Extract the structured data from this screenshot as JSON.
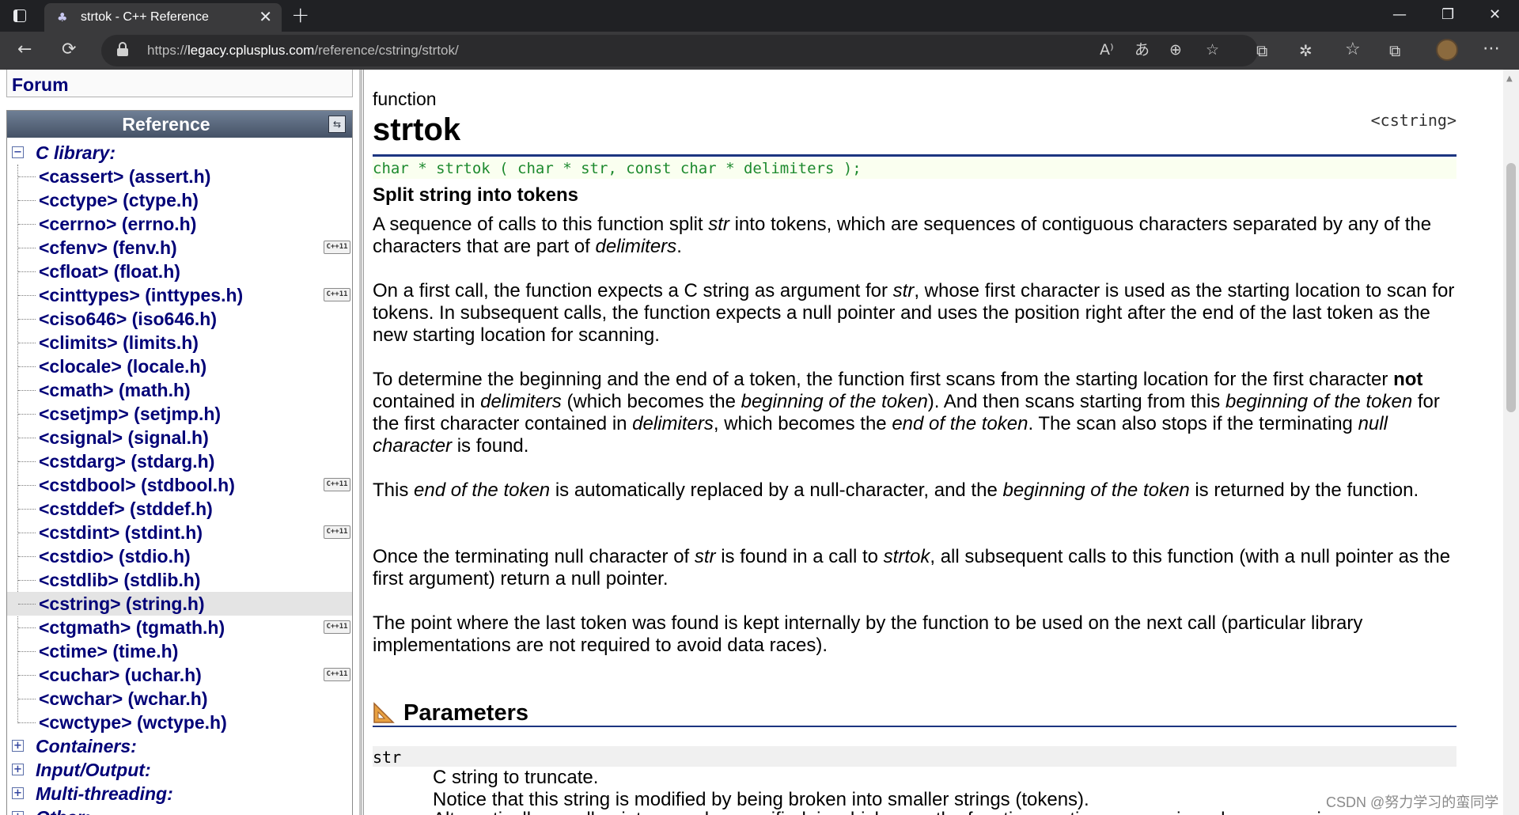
{
  "browser": {
    "tab_title": "strtok - C++ Reference",
    "url_prefix": "https://",
    "url_host": "legacy.cplusplus.com",
    "url_path": "/reference/cstring/strtok/",
    "close_glyph": "✕",
    "new_tab_glyph": "+",
    "minimize_glyph": "—",
    "maximize_glyph": "❐",
    "window_close_glyph": "✕",
    "icons": {
      "back": "←",
      "refresh": "⟳",
      "read_aloud": "A⁾",
      "translate": "あ",
      "zoom": "⊕",
      "favorite_add": "☆",
      "extension1": "⧉",
      "extension2": "✲",
      "favorites": "☆",
      "collections": "⧉",
      "more": "⋯"
    }
  },
  "sidebar": {
    "forum_label": "Forum",
    "reference_title": "Reference",
    "ref_toggle_glyph": "⇆",
    "expanded_category": "C library:",
    "expander_minus": "−",
    "expander_plus": "+",
    "libraries": [
      {
        "label": "<cassert> (assert.h)",
        "cpp": false
      },
      {
        "label": "<cctype> (ctype.h)",
        "cpp": false
      },
      {
        "label": "<cerrno> (errno.h)",
        "cpp": false
      },
      {
        "label": "<cfenv> (fenv.h)",
        "cpp": true
      },
      {
        "label": "<cfloat> (float.h)",
        "cpp": false
      },
      {
        "label": "<cinttypes> (inttypes.h)",
        "cpp": true
      },
      {
        "label": "<ciso646> (iso646.h)",
        "cpp": false
      },
      {
        "label": "<climits> (limits.h)",
        "cpp": false
      },
      {
        "label": "<clocale> (locale.h)",
        "cpp": false
      },
      {
        "label": "<cmath> (math.h)",
        "cpp": false
      },
      {
        "label": "<csetjmp> (setjmp.h)",
        "cpp": false
      },
      {
        "label": "<csignal> (signal.h)",
        "cpp": false
      },
      {
        "label": "<cstdarg> (stdarg.h)",
        "cpp": false
      },
      {
        "label": "<cstdbool> (stdbool.h)",
        "cpp": true
      },
      {
        "label": "<cstddef> (stddef.h)",
        "cpp": false
      },
      {
        "label": "<cstdint> (stdint.h)",
        "cpp": true
      },
      {
        "label": "<cstdio> (stdio.h)",
        "cpp": false
      },
      {
        "label": "<cstdlib> (stdlib.h)",
        "cpp": false
      },
      {
        "label": "<cstring> (string.h)",
        "cpp": false,
        "selected": true
      },
      {
        "label": "<ctgmath> (tgmath.h)",
        "cpp": true
      },
      {
        "label": "<ctime> (time.h)",
        "cpp": false
      },
      {
        "label": "<cuchar> (uchar.h)",
        "cpp": true
      },
      {
        "label": "<cwchar> (wchar.h)",
        "cpp": false
      },
      {
        "label": "<cwctype> (wctype.h)",
        "cpp": false
      }
    ],
    "cpp_badge": "C++11",
    "collapsed_categories": [
      "Containers:",
      "Input/Output:",
      "Multi-threading:",
      "Other:"
    ]
  },
  "main": {
    "entity_type": "function",
    "name": "strtok",
    "header": "<cstring>",
    "prototype": "char * strtok ( char * str, const char * delimiters );",
    "short_description": "Split string into tokens",
    "paragraphs": {
      "p1": {
        "a": "A sequence of calls to this function split ",
        "b": "str",
        "c": " into tokens, which are sequences of contiguous characters separated by any of the characters that are part of ",
        "d": "delimiters",
        "e": "."
      },
      "p2": {
        "a": "On a first call, the function expects a C string as argument for ",
        "b": "str",
        "c": ", whose first character is used as the starting location to scan for tokens. In subsequent calls, the function expects a null pointer and uses the position right after the end of the last token as the new starting location for scanning."
      },
      "p3": {
        "a": "To determine the beginning and the end of a token, the function first scans from the starting location for the first character ",
        "b": "not",
        "c": " contained in ",
        "d": "delimiters",
        "e": " (which becomes the ",
        "f": "beginning of the token",
        "g": "). And then scans starting from this ",
        "h": "beginning of the token",
        "i": " for the first character contained in ",
        "j": "delimiters",
        "k": ", which becomes the ",
        "l": "end of the token",
        "m": ". The scan also stops if the terminating ",
        "n": "null character",
        "o": " is found."
      },
      "p4": {
        "a": "This ",
        "b": "end of the token",
        "c": " is automatically replaced by a null-character, and the ",
        "d": "beginning of the token",
        "e": " is returned by the function."
      },
      "p5": {
        "a": "Once the terminating null character of ",
        "b": "str",
        "c": " is found in a call to ",
        "d": "strtok",
        "e": ", all subsequent calls to this function (with a null pointer as the first argument) return a null pointer."
      },
      "p6": "The point where the last token was found is kept internally by the function to be used on the next call (particular library implementations are not required to avoid data races)."
    },
    "parameters": {
      "title": "Parameters",
      "items": [
        {
          "name": "str",
          "desc1": "C string to truncate.",
          "desc2": "Notice that this string is modified by being broken into smaller strings (tokens).",
          "desc3": "Alternativelly, a null pointer may be specified, in which case the function continues scanning where a previous"
        }
      ]
    }
  },
  "watermark": "CSDN @努力学习的蛮同学",
  "colors": {
    "link": "#000077",
    "prototype_text": "#1d8a2e",
    "rule": "#1c3580",
    "browser_dark": "#202124"
  }
}
